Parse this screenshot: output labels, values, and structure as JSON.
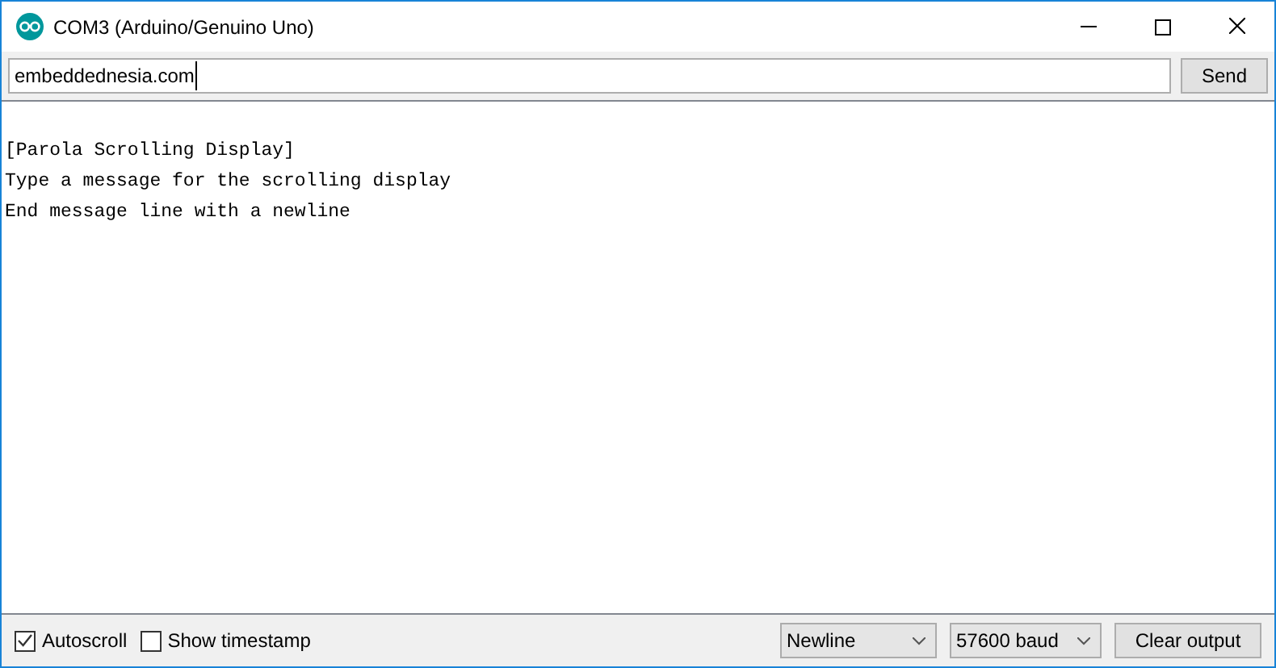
{
  "window": {
    "title": "COM3 (Arduino/Genuino Uno)"
  },
  "input": {
    "value": "embeddednesia.com"
  },
  "send_button": "Send",
  "output": [
    "[Parola Scrolling Display]",
    "Type a message for the scrolling display",
    "End message line with a newline"
  ],
  "options": [
    {
      "label": "Autoscroll",
      "checked": true
    },
    {
      "label": "Show timestamp",
      "checked": false
    }
  ],
  "line_ending": "Newline",
  "baud_rate": "57600 baud",
  "clear_button": "Clear output"
}
